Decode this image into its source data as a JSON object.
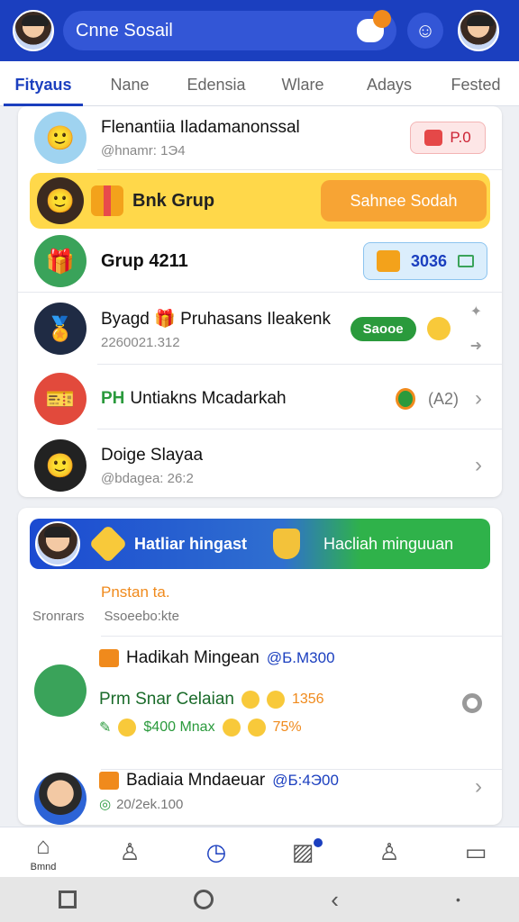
{
  "header": {
    "search_text": "Cnne Sosail"
  },
  "tabs": [
    "Fityaus",
    "Nane",
    "Edensia",
    "Wlare",
    "Adays",
    "Fested"
  ],
  "list": [
    {
      "title": "Flenantiia Iladamanonssal",
      "sub": "@hnamr: 1Э4",
      "badge": "P.0"
    },
    {
      "title": "Bnk Grup",
      "button": "Sahnee Sodah"
    },
    {
      "title": "Grup 4211",
      "badge": "3036"
    },
    {
      "title": "Byagd 🎁 Pruhasans Ileakenk",
      "sub": "2260021.312",
      "pill": "Saooe"
    },
    {
      "pre": "PH",
      "title": "Untiakns Mcadarkah",
      "count": "(A2)"
    },
    {
      "title": "Doige Slayaa",
      "sub": "@bdagea: 26:2"
    }
  ],
  "banner": {
    "left": "Hatliar hingast",
    "right": "Hacliah minguuan"
  },
  "section": {
    "title": "Pnstan ta.",
    "label": "Sronrars",
    "sub": "Ssoeebo:kte"
  },
  "hadikah": {
    "l1": "Hadikah Mingean",
    "l1_val": "@Б.М300",
    "l2": "Prm Snar Celaian",
    "l2_val": "1356",
    "l3": "$400 Mnax",
    "l3_val": "75%"
  },
  "last": {
    "title": "Badiaia Mndaeuar",
    "val": "@Б:4Э00",
    "sub": "20/2ek.100"
  },
  "bottom_nav": [
    "Bmnd"
  ]
}
